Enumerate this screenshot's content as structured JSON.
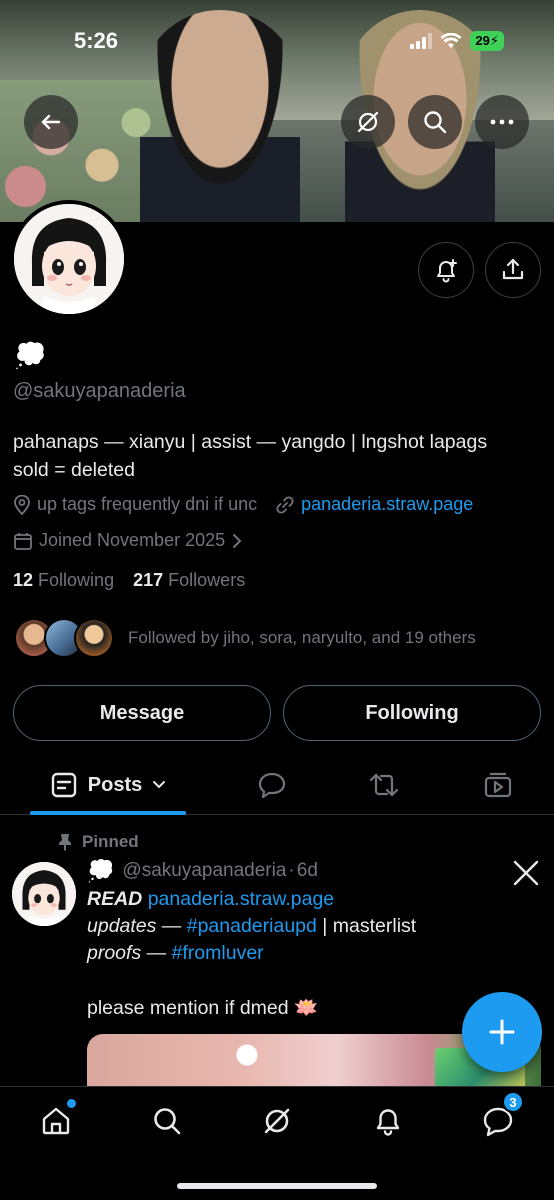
{
  "status_bar": {
    "time": "5:26",
    "battery": "29"
  },
  "profile": {
    "display_name": "💭",
    "handle": "@sakuyapanaderia",
    "bio_line1": "pahanaps — xianyu | assist — yangdo | lngshot lapags",
    "bio_line2": "sold = deleted",
    "location": "up tags frequently dni if unc",
    "website": "panaderia.straw.page",
    "joined": "Joined November 2025",
    "following_count": "12",
    "following_label": "Following",
    "followers_count": "217",
    "followers_label": "Followers",
    "followed_by": "Followed by jiho, sora, naryulto, and 19 others"
  },
  "actions": {
    "message": "Message",
    "following": "Following"
  },
  "tabs": {
    "posts": "Posts"
  },
  "post": {
    "pinned_label": "Pinned",
    "author_emoji": "💭",
    "author_handle": "@sakuyapanaderia",
    "separator": "·",
    "time": "6d",
    "line1_bold": "READ",
    "line1_link": "panaderia.straw.page",
    "line2_italic": "updates —",
    "line2_tag": "#panaderiaupd",
    "line2_rest": "| masterlist",
    "line3_italic": "proofs —",
    "line3_tag": "#fromluver",
    "line4": "please mention if dmed 🪷"
  },
  "bottom_nav": {
    "messages_badge": "3"
  },
  "colors": {
    "accent": "#1d9bf0",
    "muted": "#71767b",
    "background": "#000000"
  }
}
